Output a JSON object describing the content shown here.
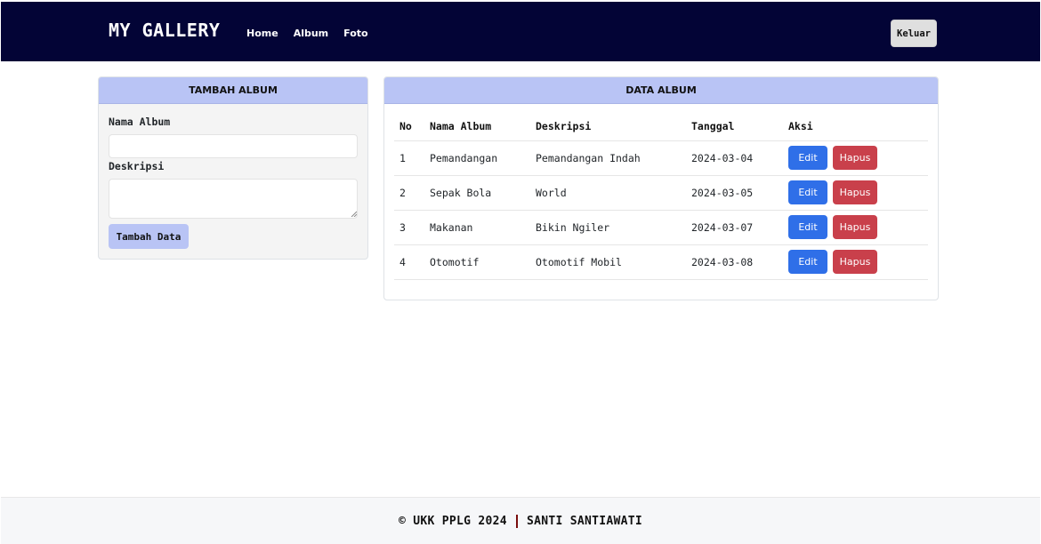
{
  "navbar": {
    "brand": "MY GALLERY",
    "links": [
      {
        "label": "Home"
      },
      {
        "label": "Album"
      },
      {
        "label": "Foto"
      }
    ],
    "logout_label": "Keluar",
    "bg_color": "#030436"
  },
  "add_album": {
    "header": "TAMBAH ALBUM",
    "name_label": "Nama Album",
    "name_value": "",
    "description_label": "Deskripsi",
    "description_value": "",
    "submit_label": "Tambah Data"
  },
  "album_data": {
    "header": "DATA ALBUM",
    "columns": [
      "No",
      "Nama Album",
      "Deskripsi",
      "Tanggal",
      "Aksi"
    ],
    "rows": [
      {
        "no": "1",
        "name": "Pemandangan",
        "description": "Pemandangan Indah",
        "date": "2024-03-04",
        "edit_label": "Edit",
        "delete_label": "Hapus"
      },
      {
        "no": "2",
        "name": "Sepak Bola",
        "description": "World",
        "date": "2024-03-05",
        "edit_label": "Edit",
        "delete_label": "Hapus"
      },
      {
        "no": "3",
        "name": "Makanan",
        "description": "Bikin Ngiler",
        "date": "2024-03-07",
        "edit_label": "Edit",
        "delete_label": "Hapus"
      },
      {
        "no": "4",
        "name": "Otomotif",
        "description": "Otomotif Mobil",
        "date": "2024-03-08",
        "edit_label": "Edit",
        "delete_label": "Hapus"
      }
    ]
  },
  "footer": {
    "left": "© UKK PPLG 2024",
    "right": "SANTI SANTIAWATI"
  },
  "colors": {
    "accent": "#b9c4f5",
    "edit": "#2f6fe8",
    "delete": "#c9404b"
  }
}
